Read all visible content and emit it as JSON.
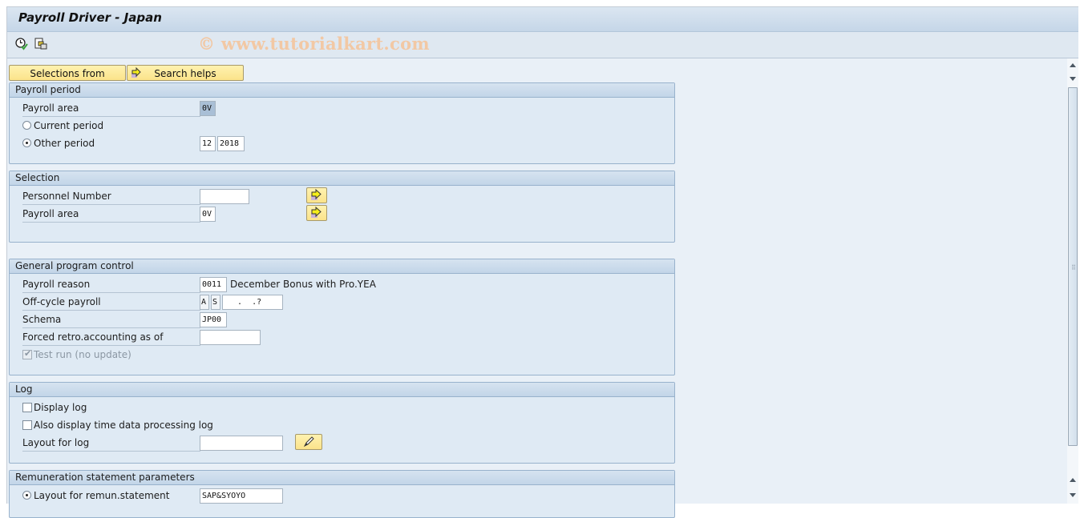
{
  "window": {
    "title": "Payroll Driver - Japan",
    "watermark": "© www.tutorialkart.com"
  },
  "toolbar": {
    "icons": [
      "execute-clock-icon",
      "get-variant-icon"
    ]
  },
  "buttons": {
    "selections_from": "Selections from",
    "search_helps": "Search helps"
  },
  "groups": {
    "payroll_period": {
      "title": "Payroll period",
      "payroll_area_label": "Payroll area",
      "payroll_area_value": "0V",
      "current_period_label": "Current period",
      "current_period_selected": false,
      "other_period_label": "Other period",
      "other_period_selected": true,
      "period_value": "12",
      "year_value": "2018"
    },
    "selection": {
      "title": "Selection",
      "personnel_number_label": "Personnel Number",
      "personnel_number_value": "",
      "payroll_area_label": "Payroll area",
      "payroll_area_value": "0V"
    },
    "general": {
      "title": "General program control",
      "payroll_reason_label": "Payroll reason",
      "payroll_reason_value": "0011",
      "payroll_reason_desc": "December Bonus with Pro.YEA",
      "offcycle_label": "Off-cycle payroll",
      "offcycle_a": "A",
      "offcycle_s": "S",
      "offcycle_date": " .  .?",
      "schema_label": "Schema",
      "schema_value": "JP00",
      "forced_retro_label": "Forced retro.accounting as of",
      "forced_retro_value": "",
      "test_run_label": "Test run (no update)",
      "test_run_checked": true
    },
    "log": {
      "title": "Log",
      "display_log_label": "Display log",
      "display_log_checked": false,
      "time_log_label": "Also display time data processing log",
      "time_log_checked": false,
      "layout_label": "Layout for log",
      "layout_value": ""
    },
    "remun": {
      "title": "Remuneration statement parameters",
      "layout_label": "Layout for remun.statement",
      "layout_selected": true,
      "layout_value": "SAP&SYOYO"
    }
  }
}
